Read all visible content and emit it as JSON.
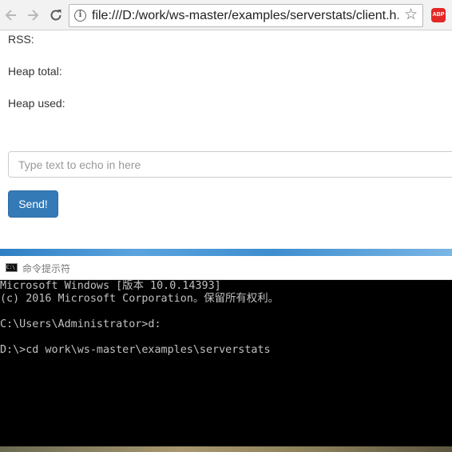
{
  "browser": {
    "url": "file:///D:/work/ws-master/examples/serverstats/client.h...",
    "abp_label": "ABP",
    "icons": {
      "back": "arrow-left-icon",
      "forward": "arrow-right-icon",
      "reload": "reload-icon",
      "info": "info-icon",
      "bookmark": "star-icon",
      "adblock": "abp-icon"
    }
  },
  "page": {
    "stats": {
      "rss_label": "RSS:",
      "heap_total_label": "Heap total:",
      "heap_used_label": "Heap used:"
    },
    "echo_input": {
      "placeholder": "Type text to echo in here",
      "value": ""
    },
    "send_label": "Send!",
    "colors": {
      "send_button": "#337ab7"
    }
  },
  "console": {
    "title": "命令提示符",
    "lines": [
      "Microsoft Windows [版本 10.0.14393]",
      "(c) 2016 Microsoft Corporation。保留所有权利。",
      "",
      "C:\\Users\\Administrator>d:",
      "",
      "D:\\>cd work\\ws-master\\examples\\serverstats"
    ]
  }
}
